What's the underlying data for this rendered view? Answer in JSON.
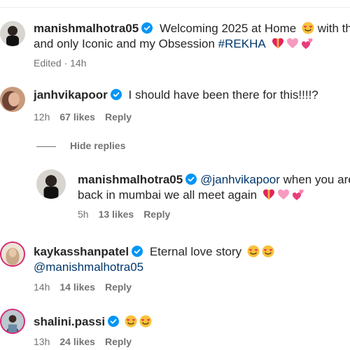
{
  "comments": [
    {
      "username": "manishmalhotra05",
      "text_a": " Welcoming 2025 at Home ",
      "text_b": " with the one",
      "text_c": "and only Iconic and my Obsession ",
      "hashtag": "#REKHA",
      "emojis": [
        "heart-with-ribbon",
        "pink-heart",
        "two-hearts"
      ],
      "meta": {
        "edited": "Edited · 14h"
      }
    },
    {
      "username": "janhvikapoor",
      "text": " I should have been there for this!!!!?",
      "meta": {
        "time": "12h",
        "likes": "67 likes",
        "reply": "Reply"
      }
    },
    {
      "hide_replies": "Hide replies"
    },
    {
      "username": "manishmalhotra05",
      "mention": "@janhvikapoor",
      "text_a": " when you are",
      "text_b": "back in mumbai we all meet again ",
      "emojis": [
        "heart-with-ribbon",
        "pink-heart",
        "two-hearts"
      ],
      "meta": {
        "time": "5h",
        "likes": "13 likes",
        "reply": "Reply"
      }
    },
    {
      "username": "kaykasshanpatel",
      "text": " Eternal love story ",
      "mention": "@manishmalhotra05",
      "emojis": [
        "smiling-face-with-heart-eyes",
        "smiling-face-with-heart-eyes"
      ],
      "meta": {
        "time": "14h",
        "likes": "14 likes",
        "reply": "Reply"
      }
    },
    {
      "username": "shalini.passi",
      "emojis": [
        "smiling-face-with-heart-eyes",
        "smiling-face-with-heart-eyes"
      ],
      "meta": {
        "time": "13h",
        "likes": "24 likes",
        "reply": "Reply"
      }
    }
  ],
  "colors": {
    "text": "#262626",
    "meta": "#737373",
    "link": "#00376b",
    "verified": "#0095f6",
    "story_ring": "#d62976"
  }
}
